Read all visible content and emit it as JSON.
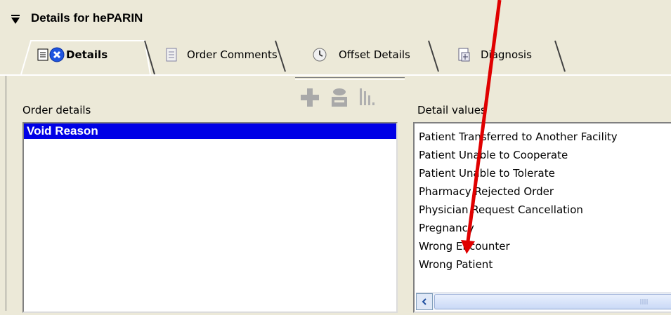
{
  "header": {
    "title": "Details for hePARIN"
  },
  "tabs": [
    {
      "label": "Details",
      "icon": "details-icon",
      "active": true
    },
    {
      "label": "Order Comments",
      "icon": "comments-icon",
      "active": false
    },
    {
      "label": "Offset Details",
      "icon": "clock-icon",
      "active": false
    },
    {
      "label": "Diagnosis",
      "icon": "diagnosis-icon",
      "active": false
    }
  ],
  "order_details": {
    "label": "Order details",
    "items": [
      "Void Reason"
    ],
    "selected": "Void Reason"
  },
  "detail_values": {
    "label": "Detail values",
    "items": [
      "Patient Transferred to Another Facility",
      "Patient Unable to Cooperate",
      "Patient Unable to Tolerate",
      "Pharmacy Rejected Order",
      "Physician Request Cancellation",
      "Pregnancy",
      "Wrong Encounter",
      "Wrong Patient"
    ]
  },
  "colors": {
    "selection": "#0000e6",
    "annotation_arrow": "#e00000",
    "background": "#ece9d8"
  }
}
